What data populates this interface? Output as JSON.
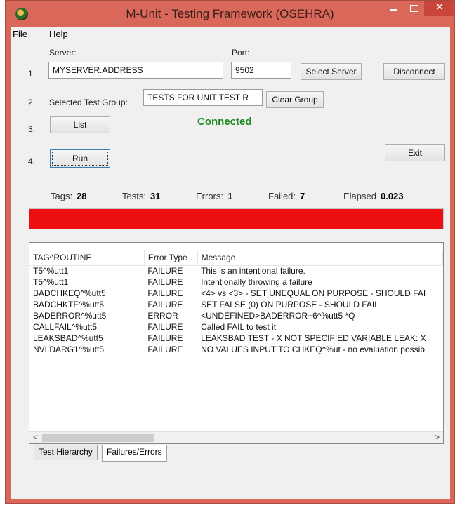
{
  "window": {
    "title": "M-Unit - Testing Framework (OSEHRA)",
    "close_glyph": "✕"
  },
  "menu": {
    "file": "File",
    "help": "Help"
  },
  "steps": {
    "s1": "1.",
    "s2": "2.",
    "s3": "3.",
    "s4": "4."
  },
  "server": {
    "label": "Server:",
    "value": "MYSERVER.ADDRESS"
  },
  "port": {
    "label": "Port:",
    "value": "9502"
  },
  "buttons": {
    "select_server": "Select Server",
    "disconnect": "Disconnect",
    "clear_group": "Clear Group",
    "list": "List",
    "run": "Run",
    "exit": "Exit"
  },
  "test_group": {
    "label": "Selected Test Group:",
    "value": "TESTS FOR UNIT TEST R"
  },
  "status": {
    "text": "Connected",
    "color": "#1e8a1e"
  },
  "stats": {
    "tags_label": "Tags:",
    "tags": "28",
    "tests_label": "Tests:",
    "tests": "31",
    "errors_label": "Errors:",
    "errors": "1",
    "failed_label": "Failed:",
    "failed": "7",
    "elapsed_label": "Elapsed",
    "elapsed": "0.023"
  },
  "progress": {
    "fraction": 1.0,
    "color": "#ee1010"
  },
  "results": {
    "columns": [
      "TAG^ROUTINE",
      "Error Type",
      "Message"
    ],
    "rows": [
      [
        "T5^%utt1",
        "FAILURE",
        "This is an intentional failure."
      ],
      [
        "T5^%utt1",
        "FAILURE",
        "Intentionally throwing a failure"
      ],
      [
        "BADCHKEQ^%utt5",
        "FAILURE",
        "<4> vs <3> - SET UNEQUAL ON PURPOSE - SHOULD FAI"
      ],
      [
        "BADCHKTF^%utt5",
        "FAILURE",
        "SET FALSE (0) ON PURPOSE - SHOULD FAIL"
      ],
      [
        "BADERROR^%utt5",
        "ERROR",
        "<UNDEFINED>BADERROR+6^%utt5 *Q"
      ],
      [
        "CALLFAIL^%utt5",
        "FAILURE",
        "Called FAIL to test it"
      ],
      [
        "LEAKSBAD^%utt5",
        "FAILURE",
        "LEAKSBAD TEST - X NOT SPECIFIED VARIABLE LEAK: X"
      ],
      [
        "NVLDARG1^%utt5",
        "FAILURE",
        "NO VALUES INPUT TO CHKEQ^%ut - no evaluation possib"
      ]
    ]
  },
  "scroll": {
    "left_glyph": "<",
    "right_glyph": ">"
  },
  "tabs": [
    "Test Hierarchy",
    "Failures/Errors"
  ],
  "icons": {
    "app": "app-icon",
    "minimize": "minimize-icon",
    "maximize": "maximize-icon",
    "close": "close-icon"
  },
  "colors": {
    "window_frame": "#d9685a",
    "close_button": "#c7453a",
    "client_bg": "#f0f0f0"
  }
}
